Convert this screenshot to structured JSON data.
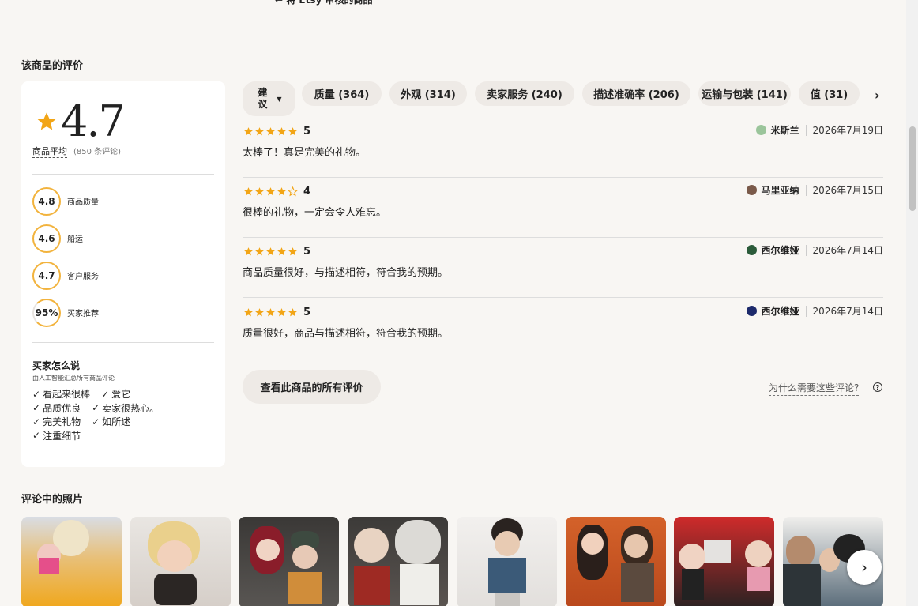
{
  "top_cut_text": "← 将 Etsy 审核的商品",
  "section_title": "该商品的评价",
  "summary": {
    "overall_rating": "4.7",
    "avg_label": "商品平均",
    "review_count": "(850 条评论)",
    "sub_ratings": [
      {
        "value": "4.8",
        "label": "商品质量"
      },
      {
        "value": "4.6",
        "label": "船运"
      },
      {
        "value": "4.7",
        "label": "客户服务"
      },
      {
        "value": "95%",
        "label": "买家推荐"
      }
    ],
    "buyers_title": "买家怎么说",
    "buyers_subtitle": "由人工智能汇总所有商品评论",
    "tags": [
      "看起来很棒",
      "爱它",
      "品质优良",
      "卖家很热心。",
      "完美礼物",
      "如所述",
      "注重细节"
    ]
  },
  "filters": {
    "sort_label_1": "建",
    "sort_label_2": "议",
    "chips": [
      "质量 (364)",
      "外观 (314)",
      "卖家服务 (240)",
      "描述准确率 (206)",
      "运输与包装 (141)",
      "值 (31)"
    ]
  },
  "reviews": [
    {
      "rating": "5",
      "text": "太棒了！真是完美的礼物。",
      "name": "米斯兰",
      "date": "2026年7月19日",
      "avatar_color": "#9bc59b"
    },
    {
      "rating": "4",
      "text": "很棒的礼物，一定会令人难忘。",
      "name": "马里亚纳",
      "date": "2026年7月15日",
      "avatar_color": "#7a5a4a"
    },
    {
      "rating": "5",
      "text": "商品质量很好，与描述相符，符合我的预期。",
      "name": "西尔维娅",
      "date": "2026年7月14日",
      "avatar_color": "#2b5b3a"
    },
    {
      "rating": "5",
      "text": "质量很好，商品与描述相符，符合我的预期。",
      "name": "西尔维娅",
      "date": "2026年7月14日",
      "avatar_color": "#1d2a6b"
    }
  ],
  "all_reviews_button": "查看此商品的所有评价",
  "why_link": "为什么需要这些评论?",
  "photos_title": "评论中的照片",
  "colors": {
    "star": "#f2a516",
    "ring": "#f2b33d",
    "chip_bg": "#eeeae6",
    "page_bg": "#f8f6f3"
  }
}
